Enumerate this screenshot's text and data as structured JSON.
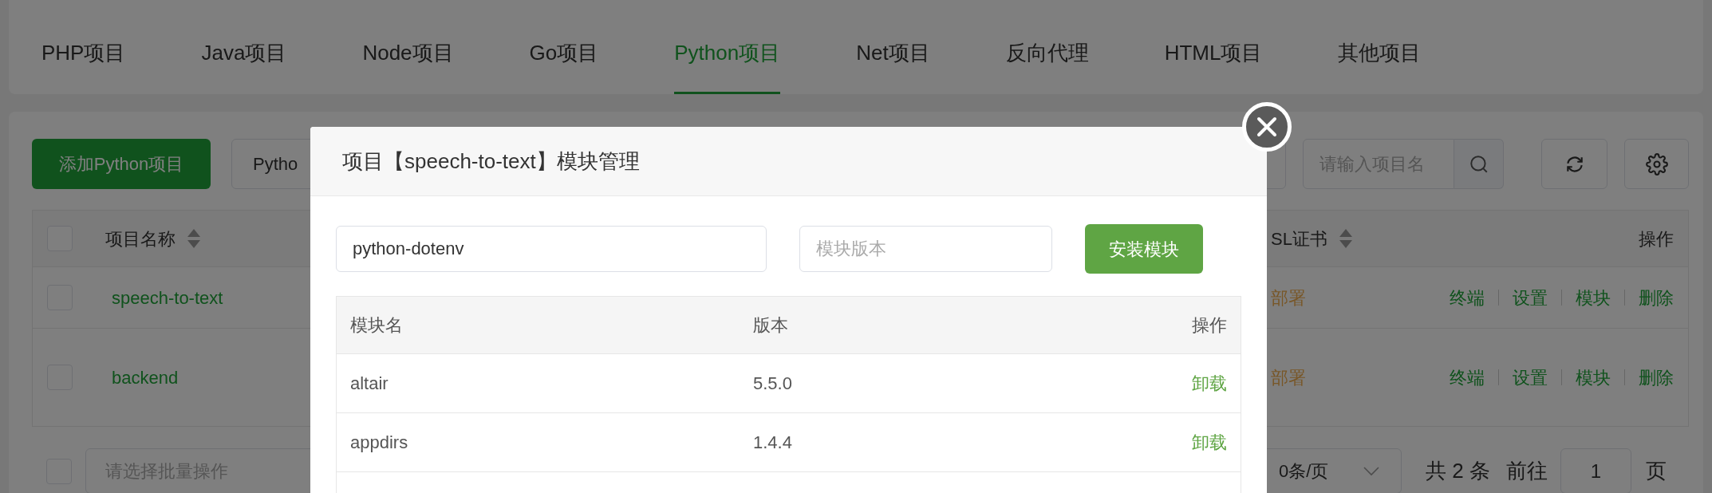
{
  "tabs": [
    {
      "label": "PHP项目",
      "selected": false
    },
    {
      "label": "Java项目",
      "selected": false
    },
    {
      "label": "Node项目",
      "selected": false
    },
    {
      "label": "Go项目",
      "selected": false
    },
    {
      "label": "Python项目",
      "selected": true
    },
    {
      "label": "Net项目",
      "selected": false
    },
    {
      "label": "反向代理",
      "selected": false
    },
    {
      "label": "HTML项目",
      "selected": false
    },
    {
      "label": "其他项目",
      "selected": false
    }
  ],
  "toolbar": {
    "add_button": "添加Python项目",
    "version_select": "Pytho",
    "search": {
      "placeholder": "请输入项目名"
    }
  },
  "projects_table": {
    "all_checked": false,
    "columns": [
      "项目名称",
      "SL证书",
      "操作"
    ],
    "rows": [
      {
        "name": "speech-to-text",
        "checked": false,
        "ssl": "部署",
        "actions": [
          "终端",
          "设置",
          "模块",
          "删除"
        ]
      },
      {
        "name": "backend",
        "checked": false,
        "ssl": "部署",
        "actions": [
          "终端",
          "设置",
          "模块",
          "删除"
        ]
      }
    ]
  },
  "footer": {
    "checked": false,
    "batch_select": {
      "placeholder": "请选择批量操作"
    },
    "page_size": "0条/页",
    "total": "共 2 条",
    "goto": "前往",
    "page": "1",
    "page_suffix": "页"
  },
  "modal": {
    "title": "项目【speech-to-text】模块管理",
    "module_field": {
      "value": "python-dotenv"
    },
    "version_field": {
      "placeholder": "模块版本"
    },
    "install_button": "安装模块",
    "table": {
      "columns": [
        "模块名",
        "版本",
        "操作"
      ],
      "rows": [
        {
          "name": "altair",
          "version": "5.5.0",
          "action": "卸载"
        },
        {
          "name": "appdirs",
          "version": "1.4.4",
          "action": "卸载"
        }
      ]
    }
  }
}
